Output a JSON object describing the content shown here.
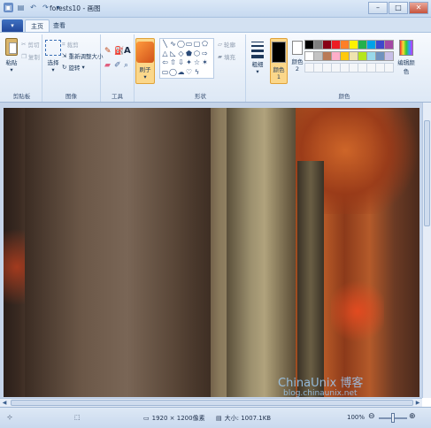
{
  "window": {
    "title": "forests10 - 画图"
  },
  "tabs": {
    "home": "主页",
    "view": "查看",
    "file": "▾"
  },
  "ribbon": {
    "clipboard": {
      "paste": "粘贴",
      "cut": "剪切",
      "copy": "复制",
      "label": "剪贴板"
    },
    "image": {
      "select": "选择",
      "crop": "裁剪",
      "resize": "重新调整大小",
      "rotate": "旋转",
      "label": "图像"
    },
    "tools": {
      "text_tool": "A",
      "label": "工具"
    },
    "brushes": {
      "label": "刷子"
    },
    "shapes": {
      "outline": "轮廓",
      "fill": "填充",
      "label": "形状"
    },
    "size": {
      "label": "粗细"
    },
    "colors": {
      "color1": "颜色 1",
      "color2": "颜色 2",
      "edit": "编辑颜色",
      "label": "颜色",
      "color1_value": "#000000",
      "color2_value": "#ffffff",
      "palette_row1": [
        "#000000",
        "#7f7f7f",
        "#880015",
        "#ed1c24",
        "#ff7f27",
        "#fff200",
        "#22b14c",
        "#00a2e8",
        "#3f48cc",
        "#a349a4"
      ],
      "palette_row2": [
        "#ffffff",
        "#c3c3c3",
        "#b97a57",
        "#ffaec9",
        "#ffc90e",
        "#efe4b0",
        "#b5e61d",
        "#99d9ea",
        "#7092be",
        "#c8bfe7"
      ]
    }
  },
  "canvas": {
    "watermark_main": "ChinaUnix 博客",
    "watermark_url": "blog.chinaunix.net"
  },
  "statusbar": {
    "dimensions": "1920 × 1200像素",
    "filesize": "大小: 1007.1KB",
    "zoom": "100%",
    "zoom_out": "⊖",
    "zoom_in": "⊕"
  }
}
